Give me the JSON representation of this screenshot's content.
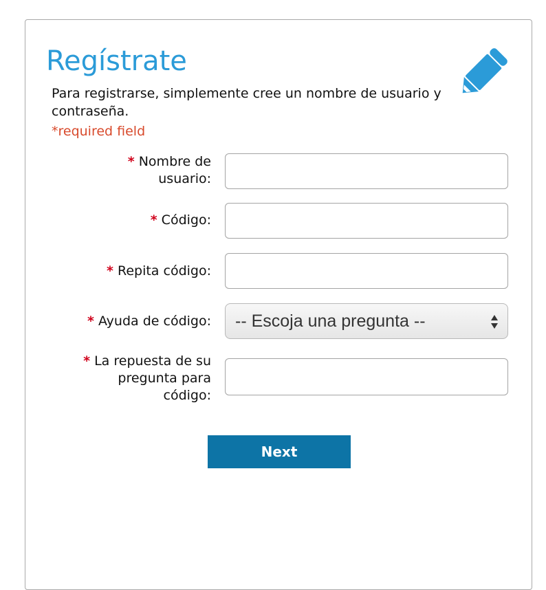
{
  "form": {
    "title": "Regístrate",
    "intro": "Para registrarse, simplemente cree un nombre de usuario y contraseña.",
    "required_note": "*required field",
    "required_marker": "*",
    "pencil_icon": "pencil-icon",
    "fields": {
      "username": {
        "label_line1": "Nombre de",
        "label_line2": "usuario:",
        "value": ""
      },
      "password": {
        "label": "Código:",
        "value": ""
      },
      "password_repeat": {
        "label": "Repita código:",
        "value": ""
      },
      "hint_question": {
        "label": "Ayuda de código:",
        "selected": "-- Escoja una pregunta --"
      },
      "hint_answer": {
        "label_line1": "La repuesta de su",
        "label_line2": "pregunta para",
        "label_line3": "código:",
        "value": ""
      }
    },
    "next_label": "Next"
  },
  "colors": {
    "title": "#2b9bd8",
    "required": "#d0021b",
    "note": "#d84a2c",
    "button": "#0d74a6"
  }
}
